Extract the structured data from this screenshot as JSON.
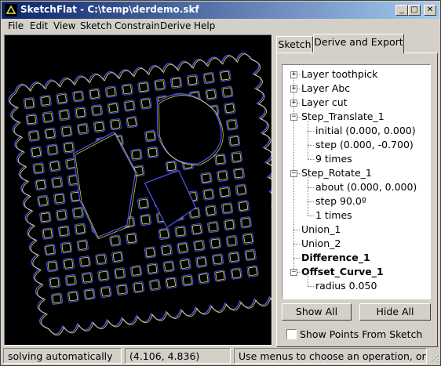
{
  "window": {
    "title": "SketchFlat - C:\\temp\\derdemo.skf"
  },
  "titlebar_buttons": {
    "minimize": "_",
    "maximize": "□",
    "close": "✕"
  },
  "menu": [
    "File",
    "Edit",
    "View",
    "Sketch",
    "Constrain",
    "Derive",
    "Help"
  ],
  "tabs": {
    "sketch": "Sketch",
    "derive": "Derive and Export",
    "active": "Derive and Export"
  },
  "tree": [
    {
      "label": "Layer toothpick",
      "depth": 0,
      "expander": "+",
      "bold": false
    },
    {
      "label": "Layer Abc",
      "depth": 0,
      "expander": "+",
      "bold": false
    },
    {
      "label": "Layer cut",
      "depth": 0,
      "expander": "+",
      "bold": false
    },
    {
      "label": "Step_Translate_1",
      "depth": 0,
      "expander": "−",
      "bold": false
    },
    {
      "label": "initial (0.000, 0.000)",
      "depth": 1,
      "expander": "",
      "bold": false
    },
    {
      "label": "step (0.000, -0.700)",
      "depth": 1,
      "expander": "",
      "bold": false
    },
    {
      "label": "9 times",
      "depth": 1,
      "expander": "",
      "bold": false
    },
    {
      "label": "Step_Rotate_1",
      "depth": 0,
      "expander": "−",
      "bold": false
    },
    {
      "label": "about (0.000, 0.000)",
      "depth": 1,
      "expander": "",
      "bold": false
    },
    {
      "label": "step 90.0º",
      "depth": 1,
      "expander": "",
      "bold": false
    },
    {
      "label": "1 times",
      "depth": 1,
      "expander": "",
      "bold": false
    },
    {
      "label": "Union_1",
      "depth": 0,
      "expander": "",
      "bold": false
    },
    {
      "label": "Union_2",
      "depth": 0,
      "expander": "",
      "bold": false
    },
    {
      "label": "Difference_1",
      "depth": 0,
      "expander": "",
      "bold": true
    },
    {
      "label": "Offset_Curve_1",
      "depth": 0,
      "expander": "−",
      "bold": true
    },
    {
      "label": "radius 0.050",
      "depth": 1,
      "expander": "",
      "bold": false
    }
  ],
  "buttons": {
    "show_all": "Show All",
    "hide_all": "Hide All"
  },
  "checkbox": {
    "label": "Show Points From Sketch",
    "checked": false
  },
  "status": {
    "mode": "solving automatically",
    "coords": "(4.106, 4.836)",
    "hint": "Use menus to choose an operation, or drag"
  },
  "colors": {
    "canvas_bg": "#000000",
    "outline_outer": "#4b57ff",
    "outline_inner": "#e8e84a",
    "title_active": "#0a246a"
  },
  "icons": {
    "app": "sketchflat-app-icon",
    "grip": "size-grip-icon"
  }
}
